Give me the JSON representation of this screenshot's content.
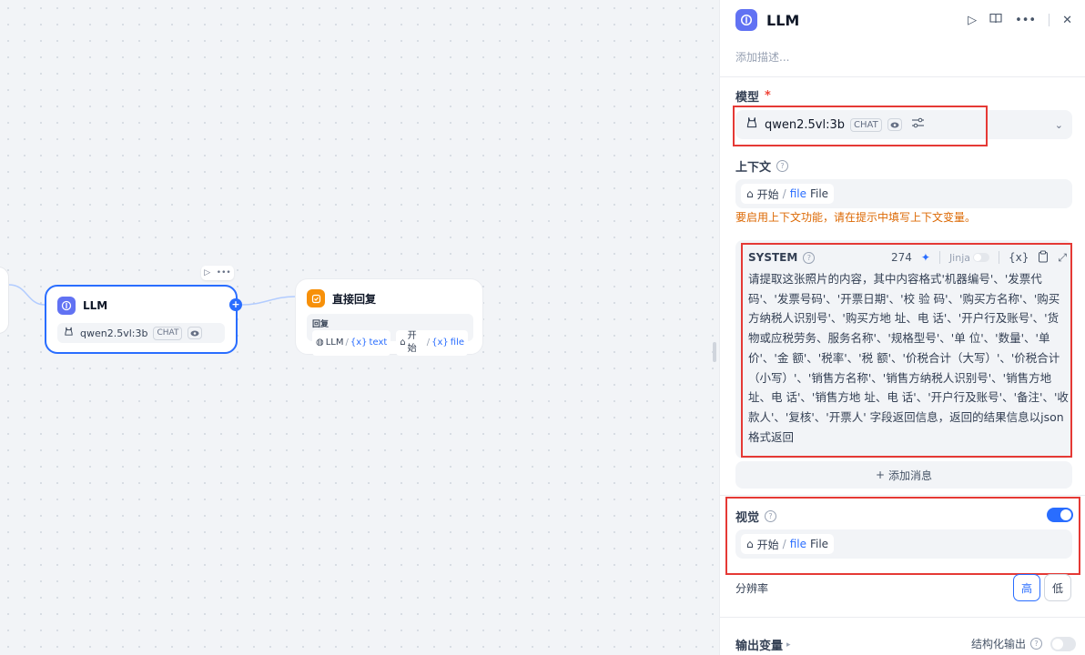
{
  "canvas": {
    "llm_node": {
      "title": "LLM",
      "model": "qwen2.5vl:3b",
      "mode_badge": "CHAT"
    },
    "reply_node": {
      "title": "直接回复",
      "label": "回复",
      "var1_source": "LLM",
      "var1_name": "text",
      "var2_source": "开始",
      "var2_name": "file"
    }
  },
  "panel": {
    "title": "LLM",
    "description_placeholder": "添加描述...",
    "model_section": {
      "label": "模型",
      "required_mark": "*",
      "model_name": "qwen2.5vl:3b",
      "mode_badge": "CHAT"
    },
    "context_section": {
      "label": "上下文",
      "chip_source": "开始",
      "chip_var": "file",
      "chip_type": "File",
      "warning": "要启用上下文功能，请在提示中填写上下文变量。"
    },
    "system_prompt": {
      "role": "SYSTEM",
      "char_count": "274",
      "jinja_label": "Jinja",
      "text": "请提取这张照片的内容，其中内容格式'机器编号'、'发票代码'、'发票号码'、'开票日期'、'校 验 码'、'购买方名称'、'购买方纳税人识别号'、'购买方地 址、电 话'、'开户行及账号'、'货物或应税劳务、服务名称'、'规格型号'、'单 位'、'数量'、'单 价'、'金 额'、'税率'、'税 额'、'价税合计（大写）'、'价税合计（小写）'、'销售方名称'、'销售方纳税人识别号'、'销售方地 址、电 话'、'销售方地 址、电 话'、'开户行及账号'、'备注'、'收款人'、'复核'、'开票人' 字段返回信息，返回的结果信息以json格式返回"
    },
    "add_message": "添加消息",
    "vision_section": {
      "label": "视觉",
      "enabled": true,
      "chip_source": "开始",
      "chip_var": "file",
      "chip_type": "File",
      "resolution_label": "分辨率",
      "resolution_high": "高",
      "resolution_low": "低",
      "resolution_selected": "高"
    },
    "output_section": {
      "label": "输出变量",
      "structured_output_label": "结构化输出",
      "structured_enabled": false
    }
  },
  "colors": {
    "accent": "#296dff",
    "highlight_border": "#e53935",
    "warning": "#dc6803",
    "llm_icon": "#6172f3",
    "reply_icon": "#f79009"
  }
}
